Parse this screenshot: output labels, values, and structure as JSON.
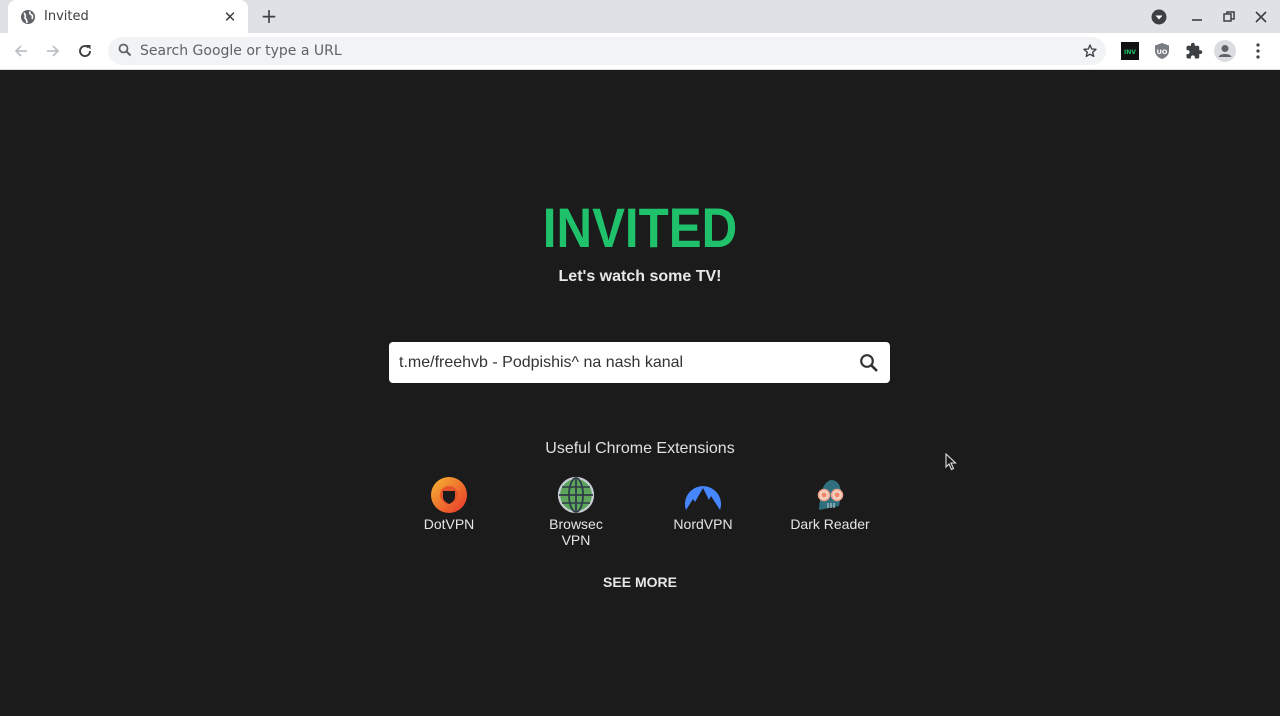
{
  "browser": {
    "tab": {
      "title": "Invited",
      "favicon": "globe-icon",
      "close_icon": "close-icon"
    },
    "new_tab_icon": "plus-icon",
    "window_controls": [
      "profile-dropdown-icon",
      "minimize-icon",
      "restore-icon",
      "close-icon"
    ],
    "nav": {
      "back": "back-arrow-icon",
      "forward": "forward-arrow-icon",
      "reload": "reload-icon"
    },
    "omnibox": {
      "placeholder": "Search Google or type a URL",
      "value": ""
    },
    "extensions": [
      {
        "name": "Invited",
        "badge": "INV"
      },
      {
        "name": "uBlock Origin",
        "badge": "UO"
      },
      {
        "name": "Extensions"
      },
      {
        "name": "Profile"
      },
      {
        "name": "Menu"
      }
    ]
  },
  "page": {
    "logo": "INVITED",
    "tagline": "Let's watch some TV!",
    "search": {
      "value": "t.me/freehvb - Podpishis^ na nash kanal",
      "icon": "search-icon"
    },
    "extensions_title": "Useful Chrome Extensions",
    "extensions": [
      {
        "label": "DotVPN",
        "icon": "dotvpn-icon"
      },
      {
        "label": "Browsec\nVPN",
        "label_line1": "Browsec",
        "label_line2": "VPN",
        "icon": "browsec-globe-icon"
      },
      {
        "label": "NordVPN",
        "icon": "nordvpn-mountain-icon"
      },
      {
        "label": "Dark Reader",
        "icon": "dark-reader-icon"
      }
    ],
    "see_more": "SEE MORE",
    "colors": {
      "accent": "#1fc26b",
      "background": "#1b1b1b",
      "text": "#e6e6e6"
    }
  }
}
